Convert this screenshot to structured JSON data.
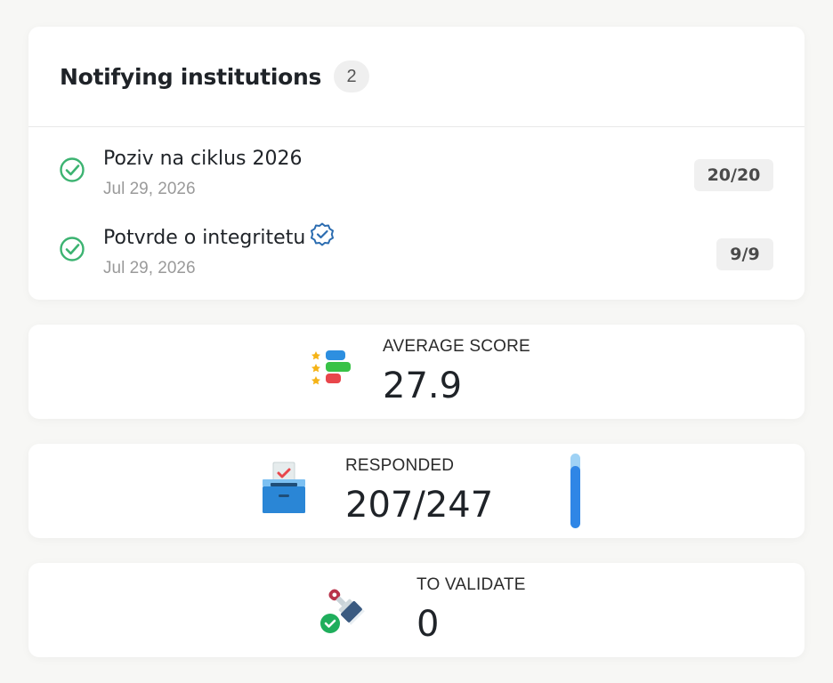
{
  "institutions": {
    "title": "Notifying institutions",
    "count": "2",
    "items": [
      {
        "title": "Poziv na ciklus 2026",
        "date": "Jul 29, 2026",
        "ratio": "20/20",
        "verified": false
      },
      {
        "title": "Potvrde o integritetu",
        "date": "Jul 29, 2026",
        "ratio": "9/9",
        "verified": true
      }
    ]
  },
  "stats": {
    "average_score": {
      "label": "AVERAGE SCORE",
      "value": "27.9",
      "icon": "score-chart-icon"
    },
    "responded": {
      "label": "RESPONDED",
      "value": "207/247",
      "progress": 0.838,
      "icon": "ballot-box-icon"
    },
    "to_validate": {
      "label": "TO VALIDATE",
      "value": "0",
      "icon": "stamp-check-icon"
    }
  },
  "colors": {
    "check_green": "#3cb371",
    "verified_blue": "#2b6cb0",
    "progress_fill": "#2f86e6",
    "progress_track": "#9fd2f5"
  }
}
